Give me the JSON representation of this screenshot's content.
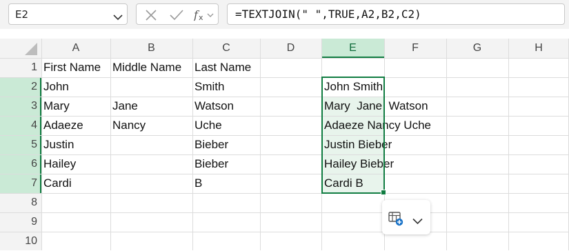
{
  "name_box": {
    "value": "E2"
  },
  "formula_bar": {
    "formula": "=TEXTJOIN(\" \",TRUE,A2,B2,C2)"
  },
  "columns": [
    "A",
    "B",
    "C",
    "D",
    "E",
    "F",
    "G",
    "H"
  ],
  "rows": [
    "1",
    "2",
    "3",
    "4",
    "5",
    "6",
    "7",
    "8",
    "9",
    "10"
  ],
  "cells": {
    "A1": "First Name",
    "B1": "Middle Name",
    "C1": "Last Name",
    "A2": "John",
    "C2": "Smith",
    "E2": "John Smith",
    "A3": "Mary",
    "B3": "Jane",
    "C3": "Watson",
    "E3": "Mary  Jane  Watson",
    "A4": "Adaeze",
    "B4": "Nancy",
    "C4": "Uche",
    "E4": "Adaeze Nancy Uche",
    "A5": "Justin",
    "C5": "Bieber",
    "E5": "Justin Bieber",
    "A6": "Hailey",
    "C6": "Bieber",
    "E6": "Hailey Bieber",
    "A7": "Cardi",
    "C7": "B",
    "E7": "Cardi B"
  },
  "selection": {
    "range": "E2:E7"
  },
  "colors": {
    "accent": "#107c41",
    "selection_fill": "#caead6",
    "header_bg": "#f3f3f3"
  },
  "icons": [
    "chevron-down-icon",
    "cancel-icon",
    "enter-icon",
    "insert-function-icon",
    "quick-analysis-icon"
  ]
}
